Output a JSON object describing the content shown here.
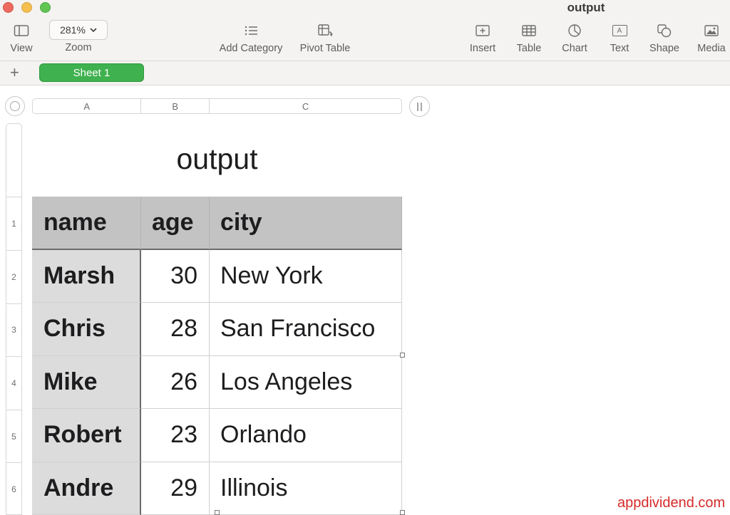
{
  "window": {
    "title": "output"
  },
  "toolbar": {
    "view_label": "View",
    "zoom_label": "Zoom",
    "zoom_value": "281%",
    "add_category_label": "Add Category",
    "pivot_table_label": "Pivot Table",
    "insert_label": "Insert",
    "table_label": "Table",
    "chart_label": "Chart",
    "text_label": "Text",
    "text_icon_glyph": "A",
    "shape_label": "Shape",
    "media_label": "Media"
  },
  "tabs": {
    "add_symbol": "+",
    "sheets": [
      {
        "label": "Sheet 1",
        "active": true
      }
    ]
  },
  "spreadsheet": {
    "columns": [
      "A",
      "B",
      "C"
    ],
    "row_numbers": [
      "1",
      "2",
      "3",
      "4",
      "5",
      "6"
    ],
    "table_title": "output",
    "header": [
      "name",
      "age",
      "city"
    ],
    "rows": [
      [
        "Marsh",
        "30",
        "New York"
      ],
      [
        "Chris",
        "28",
        "San Francisco"
      ],
      [
        "Mike",
        "26",
        "Los Angeles"
      ],
      [
        "Robert",
        "23",
        "Orlando"
      ],
      [
        "Andre",
        "29",
        "Illinois"
      ]
    ]
  },
  "watermark": {
    "text": "appdividend.com"
  },
  "colors": {
    "sheet_tab": "#3fb14e",
    "header_fill": "#c2c3c2",
    "first_column_fill": "#dcdcdc",
    "watermark": "#d62a2a"
  }
}
